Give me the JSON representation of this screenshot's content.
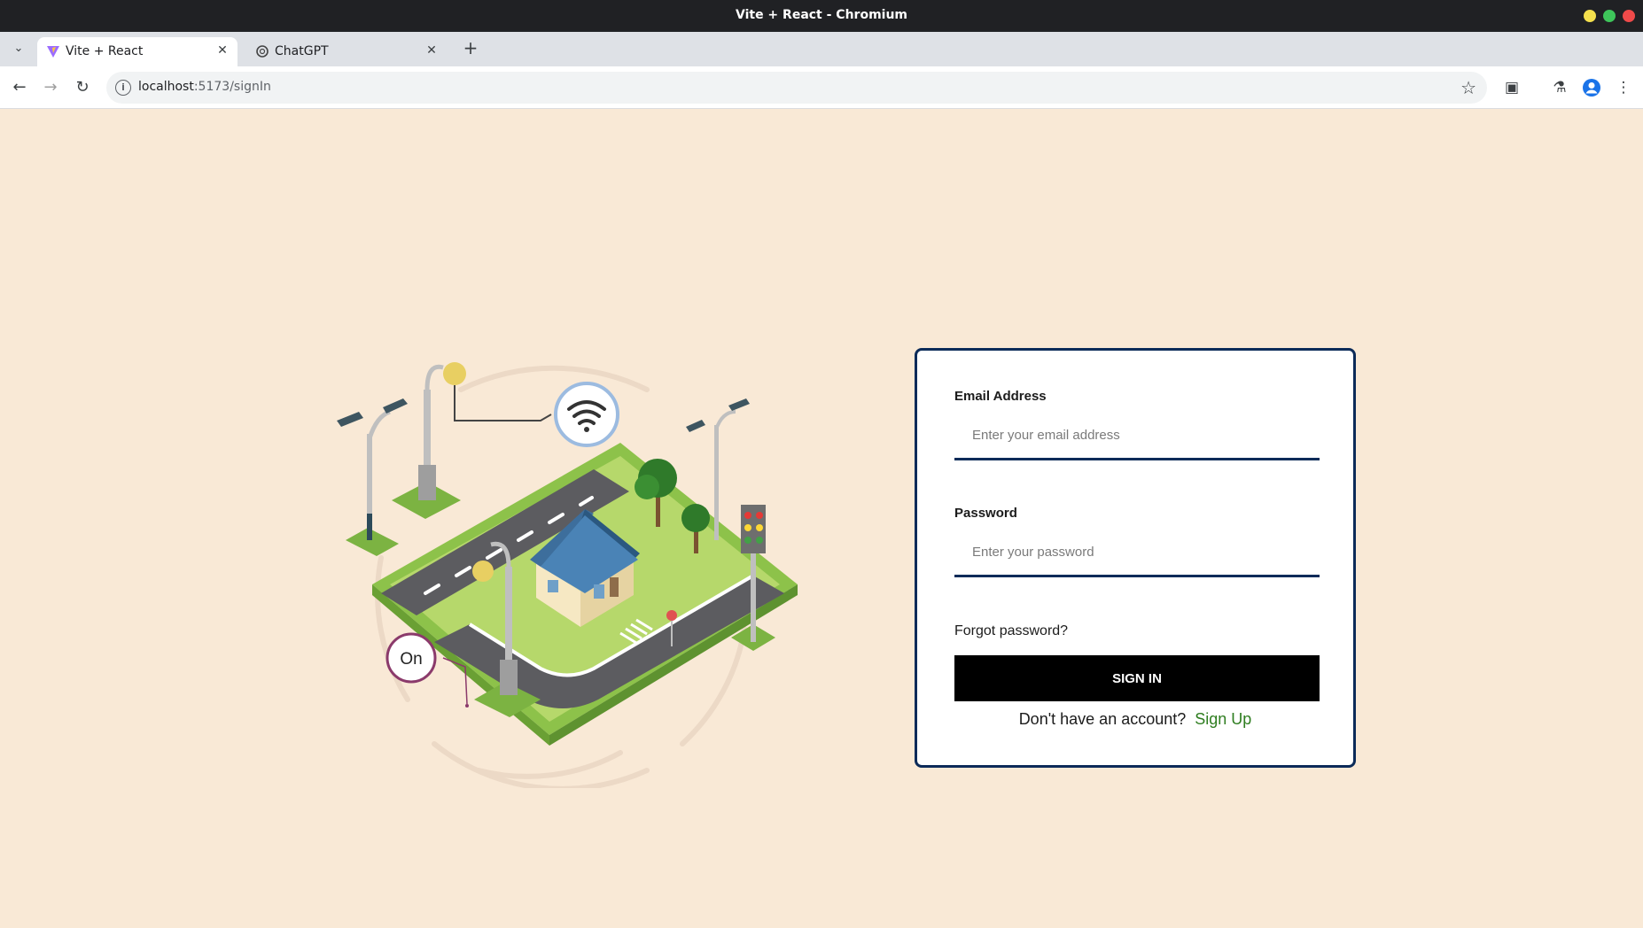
{
  "window": {
    "title": "Vite + React - Chromium"
  },
  "tabs": [
    {
      "label": "Vite + React",
      "active": true,
      "icon": "vite-icon"
    },
    {
      "label": "ChatGPT",
      "active": false,
      "icon": "chatgpt-icon"
    }
  ],
  "toolbar": {
    "url_host": "localhost",
    "url_path": ":5173/signIn"
  },
  "illustration": {
    "status_label": "On"
  },
  "form": {
    "email_label": "Email Address",
    "email_placeholder": "Enter your email address",
    "password_label": "Password",
    "password_placeholder": "Enter your password",
    "forgot_label": "Forgot password?",
    "signin_label": "SIGN IN",
    "no_account_text": "Don't have an account?",
    "signup_label": "Sign Up"
  },
  "colors": {
    "page_bg": "#f9e9d6",
    "card_border": "#0c2b59",
    "button_bg": "#000000",
    "link": "#2e7d1f"
  }
}
